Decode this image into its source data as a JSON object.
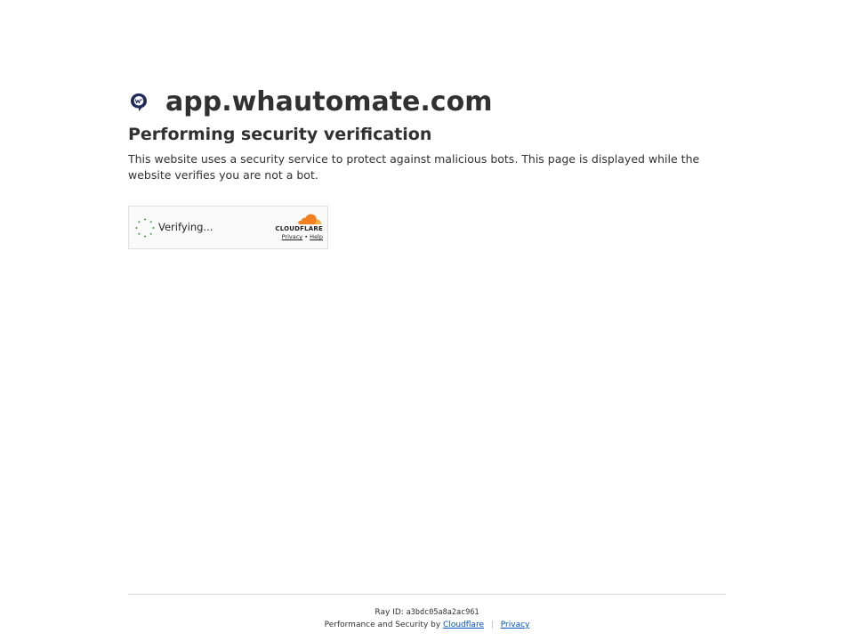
{
  "site": {
    "name": "app.whautomate.com",
    "logo_icon": "whautomate-logo-icon"
  },
  "heading": "Performing security verification",
  "description": "This website uses a security service to protect against malicious bots. This page is displayed while the website verifies you are not a bot.",
  "widget": {
    "status": "Verifying...",
    "brand": "CLOUDFLARE",
    "privacy_label": "Privacy",
    "separator": "•",
    "help_label": "Help"
  },
  "footer": {
    "ray_label": "Ray ID:",
    "ray_id": "a3bdc05a8a2ac961",
    "perf_text": "Performance and Security by",
    "cloudflare_link": "Cloudflare",
    "divider": "|",
    "privacy_link": "Privacy"
  },
  "colors": {
    "text": "#313131",
    "link": "#0051c3",
    "spinner": "#2f9e44",
    "cloudflare_orange": "#f48120",
    "logo": "#1e2a5a"
  }
}
